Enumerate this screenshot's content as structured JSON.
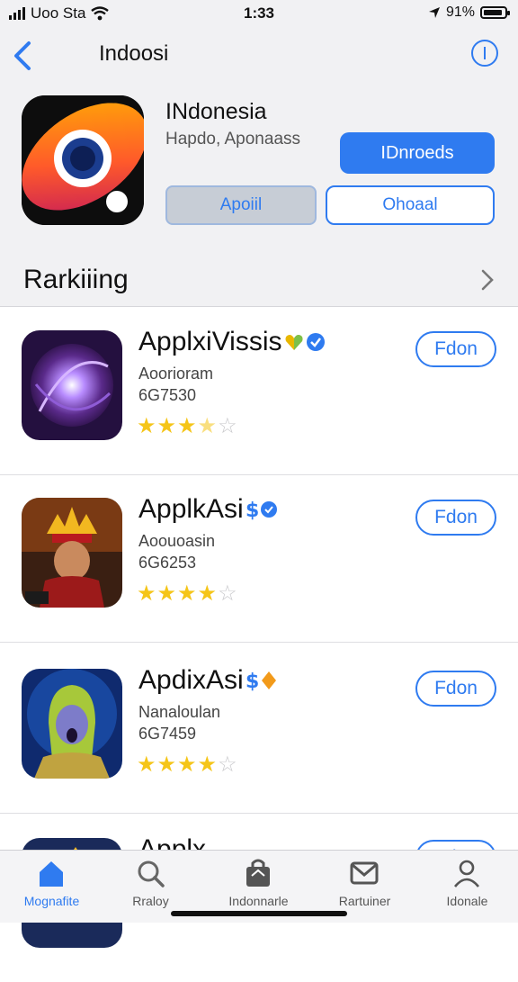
{
  "status": {
    "carrier": "Uoo Sta",
    "time": "1:33",
    "battery": "91%",
    "battery_level": 0.91
  },
  "nav": {
    "title": "Indoosi"
  },
  "hero": {
    "name": "INdonesia",
    "subtitle": "Hapdo, Aponaass",
    "primary_button": "IDnroeds",
    "secondary_button": "Apoiil",
    "outline_button": "Ohoaal"
  },
  "section": {
    "title": "Rarkiiing"
  },
  "apps": [
    {
      "name": "ApplxiVissis",
      "category": "Aoorioram",
      "number": "6G7530",
      "rating": 3.5,
      "get_label": "Fdon"
    },
    {
      "name": "ApplkAsi",
      "category": "Aoouoasin",
      "number": "6G6253",
      "rating": 4,
      "get_label": "Fdon"
    },
    {
      "name": "ApdixAsi",
      "category": "Nanaloulan",
      "number": "6G7459",
      "rating": 4,
      "get_label": "Fdon"
    },
    {
      "name": "Applx",
      "category": "",
      "number": "",
      "rating": 0,
      "get_label": "Fdon"
    }
  ],
  "tabs": [
    {
      "label": "Mognafite",
      "icon": "home-icon"
    },
    {
      "label": "Rraloy",
      "icon": "search-icon"
    },
    {
      "label": "Indonnarle",
      "icon": "bag-icon"
    },
    {
      "label": "Rartuiner",
      "icon": "mail-icon"
    },
    {
      "label": "Idonale",
      "icon": "profile-icon"
    }
  ],
  "colors": {
    "accent": "#2f7bf0",
    "star": "#f5c518"
  }
}
